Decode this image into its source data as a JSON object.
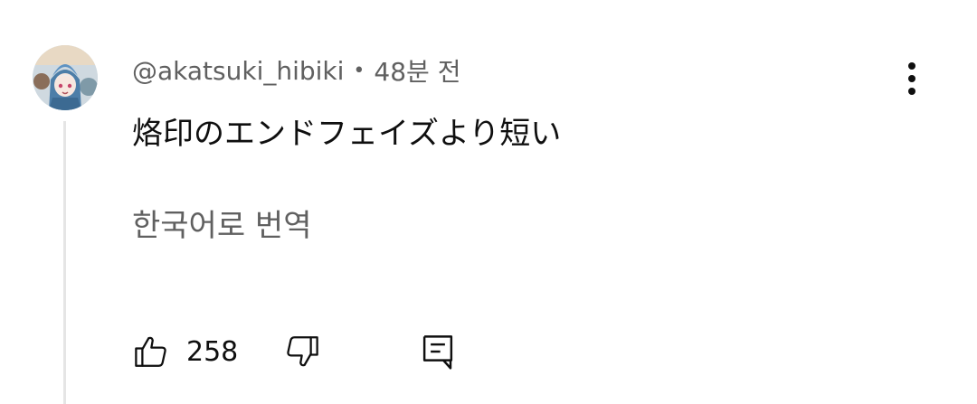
{
  "comment": {
    "author": "@akatsuki_hibiki",
    "separator": "•",
    "time": "48분 전",
    "text": "烙印のエンドフェイズより短い",
    "translate_label": "한국어로 번역",
    "like_count": "258"
  },
  "icons": {
    "avatar": "avatar-image",
    "menu": "more-vert-icon",
    "like": "thumb-up-icon",
    "dislike": "thumb-down-icon",
    "reply": "reply-comment-icon"
  },
  "colors": {
    "primary_text": "#0f0f0f",
    "secondary_text": "#606060",
    "thread_line": "#e5e5e5"
  }
}
